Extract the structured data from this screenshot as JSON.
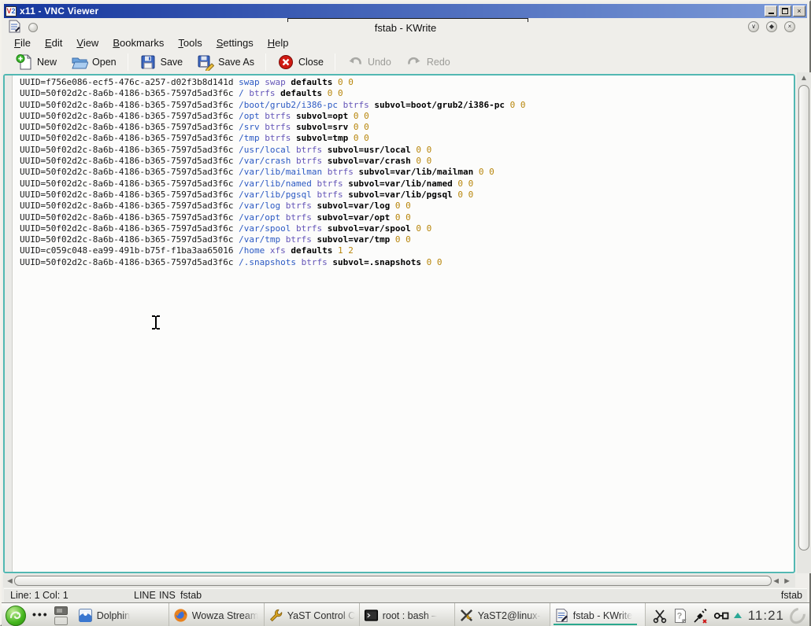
{
  "colors": {
    "titlebar-left": "#16379e",
    "titlebar-right": "#7d9bd8",
    "frame-teal": "#52b8b2",
    "syntax-mount": "#2b59c3",
    "syntax-fstype": "#6455b8",
    "syntax-number": "#b8860b",
    "active-underline": "#2aa88e",
    "geeko-green": "#45b61e"
  },
  "vnc": {
    "title": "x11 - VNC Viewer",
    "app_icon_v": "V",
    "app_icon_2": "2"
  },
  "kwrite": {
    "window_title": "fstab - KWrite",
    "deco_buttons": [
      "minimize",
      "maximize",
      "close"
    ]
  },
  "menubar": [
    "File",
    "Edit",
    "View",
    "Bookmarks",
    "Tools",
    "Settings",
    "Help"
  ],
  "toolbar": [
    {
      "label": "New",
      "icon": "new-document-icon",
      "enabled": true,
      "group_end": false
    },
    {
      "label": "Open",
      "icon": "open-folder-icon",
      "enabled": true,
      "group_end": true
    },
    {
      "label": "Save",
      "icon": "save-icon",
      "enabled": true,
      "group_end": false
    },
    {
      "label": "Save As",
      "icon": "save-as-icon",
      "enabled": true,
      "group_end": true
    },
    {
      "label": "Close",
      "icon": "close-document-icon",
      "enabled": true,
      "group_end": true
    },
    {
      "label": "Undo",
      "icon": "undo-icon",
      "enabled": false,
      "group_end": false
    },
    {
      "label": "Redo",
      "icon": "redo-icon",
      "enabled": false,
      "group_end": false
    }
  ],
  "editor": {
    "lines": [
      {
        "device": "UUID=f756e086-ecf5-476c-a257-d02f3b8d141d",
        "mount": "swap",
        "fstype": "swap",
        "options": "defaults",
        "dump": "0",
        "pass": "0"
      },
      {
        "device": "UUID=50f02d2c-8a6b-4186-b365-7597d5ad3f6c",
        "mount": "/",
        "fstype": "btrfs",
        "options": "defaults",
        "dump": "0",
        "pass": "0"
      },
      {
        "device": "UUID=50f02d2c-8a6b-4186-b365-7597d5ad3f6c",
        "mount": "/boot/grub2/i386-pc",
        "fstype": "btrfs",
        "options": "subvol=boot/grub2/i386-pc",
        "dump": "0",
        "pass": "0"
      },
      {
        "device": "UUID=50f02d2c-8a6b-4186-b365-7597d5ad3f6c",
        "mount": "/opt",
        "fstype": "btrfs",
        "options": "subvol=opt",
        "dump": "0",
        "pass": "0"
      },
      {
        "device": "UUID=50f02d2c-8a6b-4186-b365-7597d5ad3f6c",
        "mount": "/srv",
        "fstype": "btrfs",
        "options": "subvol=srv",
        "dump": "0",
        "pass": "0"
      },
      {
        "device": "UUID=50f02d2c-8a6b-4186-b365-7597d5ad3f6c",
        "mount": "/tmp",
        "fstype": "btrfs",
        "options": "subvol=tmp",
        "dump": "0",
        "pass": "0"
      },
      {
        "device": "UUID=50f02d2c-8a6b-4186-b365-7597d5ad3f6c",
        "mount": "/usr/local",
        "fstype": "btrfs",
        "options": "subvol=usr/local",
        "dump": "0",
        "pass": "0"
      },
      {
        "device": "UUID=50f02d2c-8a6b-4186-b365-7597d5ad3f6c",
        "mount": "/var/crash",
        "fstype": "btrfs",
        "options": "subvol=var/crash",
        "dump": "0",
        "pass": "0"
      },
      {
        "device": "UUID=50f02d2c-8a6b-4186-b365-7597d5ad3f6c",
        "mount": "/var/lib/mailman",
        "fstype": "btrfs",
        "options": "subvol=var/lib/mailman",
        "dump": "0",
        "pass": "0"
      },
      {
        "device": "UUID=50f02d2c-8a6b-4186-b365-7597d5ad3f6c",
        "mount": "/var/lib/named",
        "fstype": "btrfs",
        "options": "subvol=var/lib/named",
        "dump": "0",
        "pass": "0"
      },
      {
        "device": "UUID=50f02d2c-8a6b-4186-b365-7597d5ad3f6c",
        "mount": "/var/lib/pgsql",
        "fstype": "btrfs",
        "options": "subvol=var/lib/pgsql",
        "dump": "0",
        "pass": "0"
      },
      {
        "device": "UUID=50f02d2c-8a6b-4186-b365-7597d5ad3f6c",
        "mount": "/var/log",
        "fstype": "btrfs",
        "options": "subvol=var/log",
        "dump": "0",
        "pass": "0"
      },
      {
        "device": "UUID=50f02d2c-8a6b-4186-b365-7597d5ad3f6c",
        "mount": "/var/opt",
        "fstype": "btrfs",
        "options": "subvol=var/opt",
        "dump": "0",
        "pass": "0"
      },
      {
        "device": "UUID=50f02d2c-8a6b-4186-b365-7597d5ad3f6c",
        "mount": "/var/spool",
        "fstype": "btrfs",
        "options": "subvol=var/spool",
        "dump": "0",
        "pass": "0"
      },
      {
        "device": "UUID=50f02d2c-8a6b-4186-b365-7597d5ad3f6c",
        "mount": "/var/tmp",
        "fstype": "btrfs",
        "options": "subvol=var/tmp",
        "dump": "0",
        "pass": "0"
      },
      {
        "device": "UUID=c059c048-ea99-491b-b75f-f1ba3aa65016",
        "mount": "/home",
        "fstype": "xfs",
        "options": "defaults",
        "dump": "1",
        "pass": "2"
      },
      {
        "device": "UUID=50f02d2c-8a6b-4186-b365-7597d5ad3f6c",
        "mount": "/.snapshots",
        "fstype": "btrfs",
        "options": "subvol=.snapshots",
        "dump": "0",
        "pass": "0"
      }
    ]
  },
  "statusbar": {
    "position": "Line: 1 Col: 1",
    "selection_mode": "LINE",
    "insert_mode": "INS",
    "document_name": "fstab",
    "document_name_right": "fstab"
  },
  "taskbar": {
    "tasks": [
      {
        "label": "Dolphin",
        "icon": "dolphin-icon",
        "active": false
      },
      {
        "label": "Wowza Stream",
        "icon": "firefox-icon",
        "active": false
      },
      {
        "label": "YaST Control C",
        "icon": "wrench-icon",
        "active": false
      },
      {
        "label": "root : bash –",
        "icon": "terminal-icon",
        "active": false
      },
      {
        "label": "YaST2@linux-",
        "icon": "yast2-icon",
        "active": false
      },
      {
        "label": "fstab - KWrite",
        "icon": "kwrite-icon",
        "active": true
      }
    ],
    "tray": [
      "scissors-icon",
      "question-document-icon",
      "plug-disconnected-icon",
      "connector-icon"
    ],
    "clock": "11:21"
  }
}
